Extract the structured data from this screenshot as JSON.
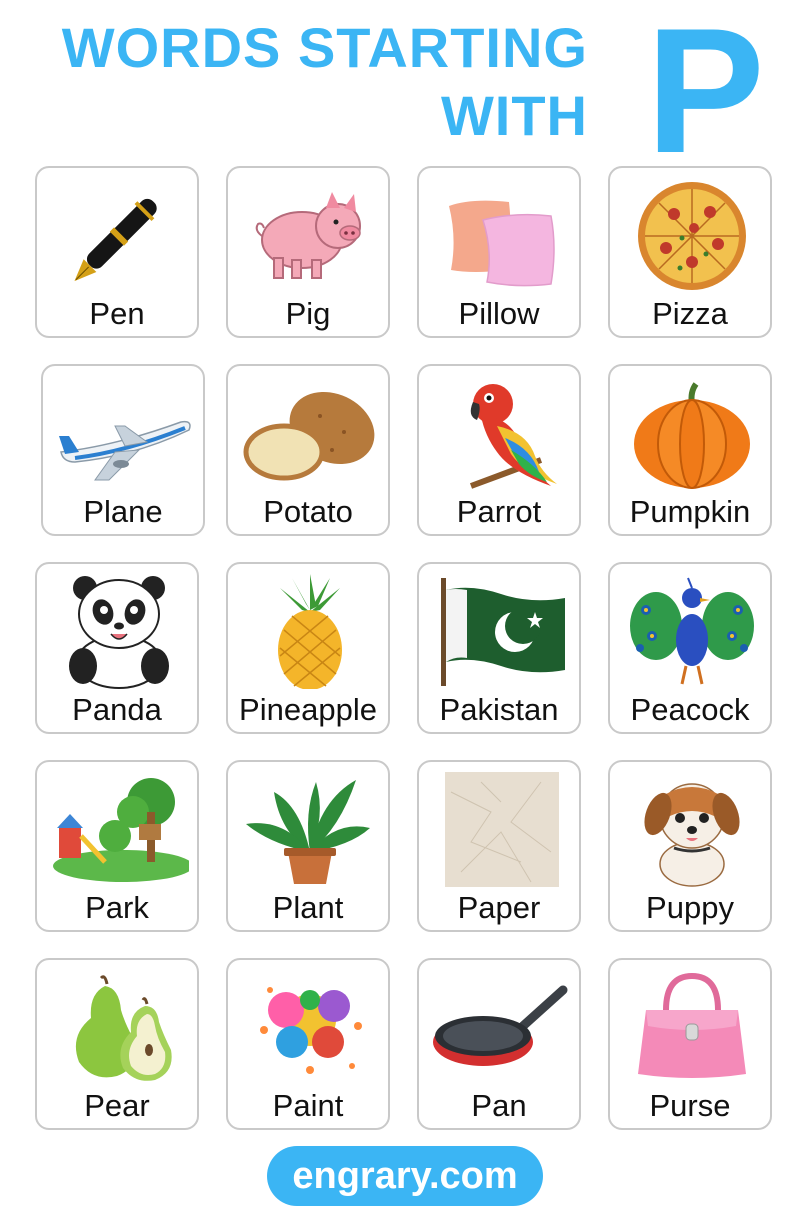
{
  "header": {
    "line1": "WORDS STARTING",
    "line2": "WITH",
    "letter": "P"
  },
  "colors": {
    "accent": "#3bb5f4",
    "card_border": "#c9c9c9"
  },
  "cards": [
    {
      "word": "Pen",
      "icon": "pen-icon"
    },
    {
      "word": "Pig",
      "icon": "pig-icon"
    },
    {
      "word": "Pillow",
      "icon": "pillow-icon"
    },
    {
      "word": "Pizza",
      "icon": "pizza-icon"
    },
    {
      "word": "Plane",
      "icon": "plane-icon"
    },
    {
      "word": "Potato",
      "icon": "potato-icon"
    },
    {
      "word": "Parrot",
      "icon": "parrot-icon"
    },
    {
      "word": "Pumpkin",
      "icon": "pumpkin-icon"
    },
    {
      "word": "Panda",
      "icon": "panda-icon"
    },
    {
      "word": "Pineapple",
      "icon": "pineapple-icon"
    },
    {
      "word": "Pakistan",
      "icon": "pakistan-flag-icon"
    },
    {
      "word": "Peacock",
      "icon": "peacock-icon"
    },
    {
      "word": "Park",
      "icon": "park-icon"
    },
    {
      "word": "Plant",
      "icon": "plant-icon"
    },
    {
      "word": "Paper",
      "icon": "paper-icon"
    },
    {
      "word": "Puppy",
      "icon": "puppy-icon"
    },
    {
      "word": "Pear",
      "icon": "pear-icon"
    },
    {
      "word": "Paint",
      "icon": "paint-splash-icon"
    },
    {
      "word": "Pan",
      "icon": "pan-icon"
    },
    {
      "word": "Purse",
      "icon": "purse-icon"
    }
  ],
  "footer": {
    "site": "engrary.com"
  }
}
